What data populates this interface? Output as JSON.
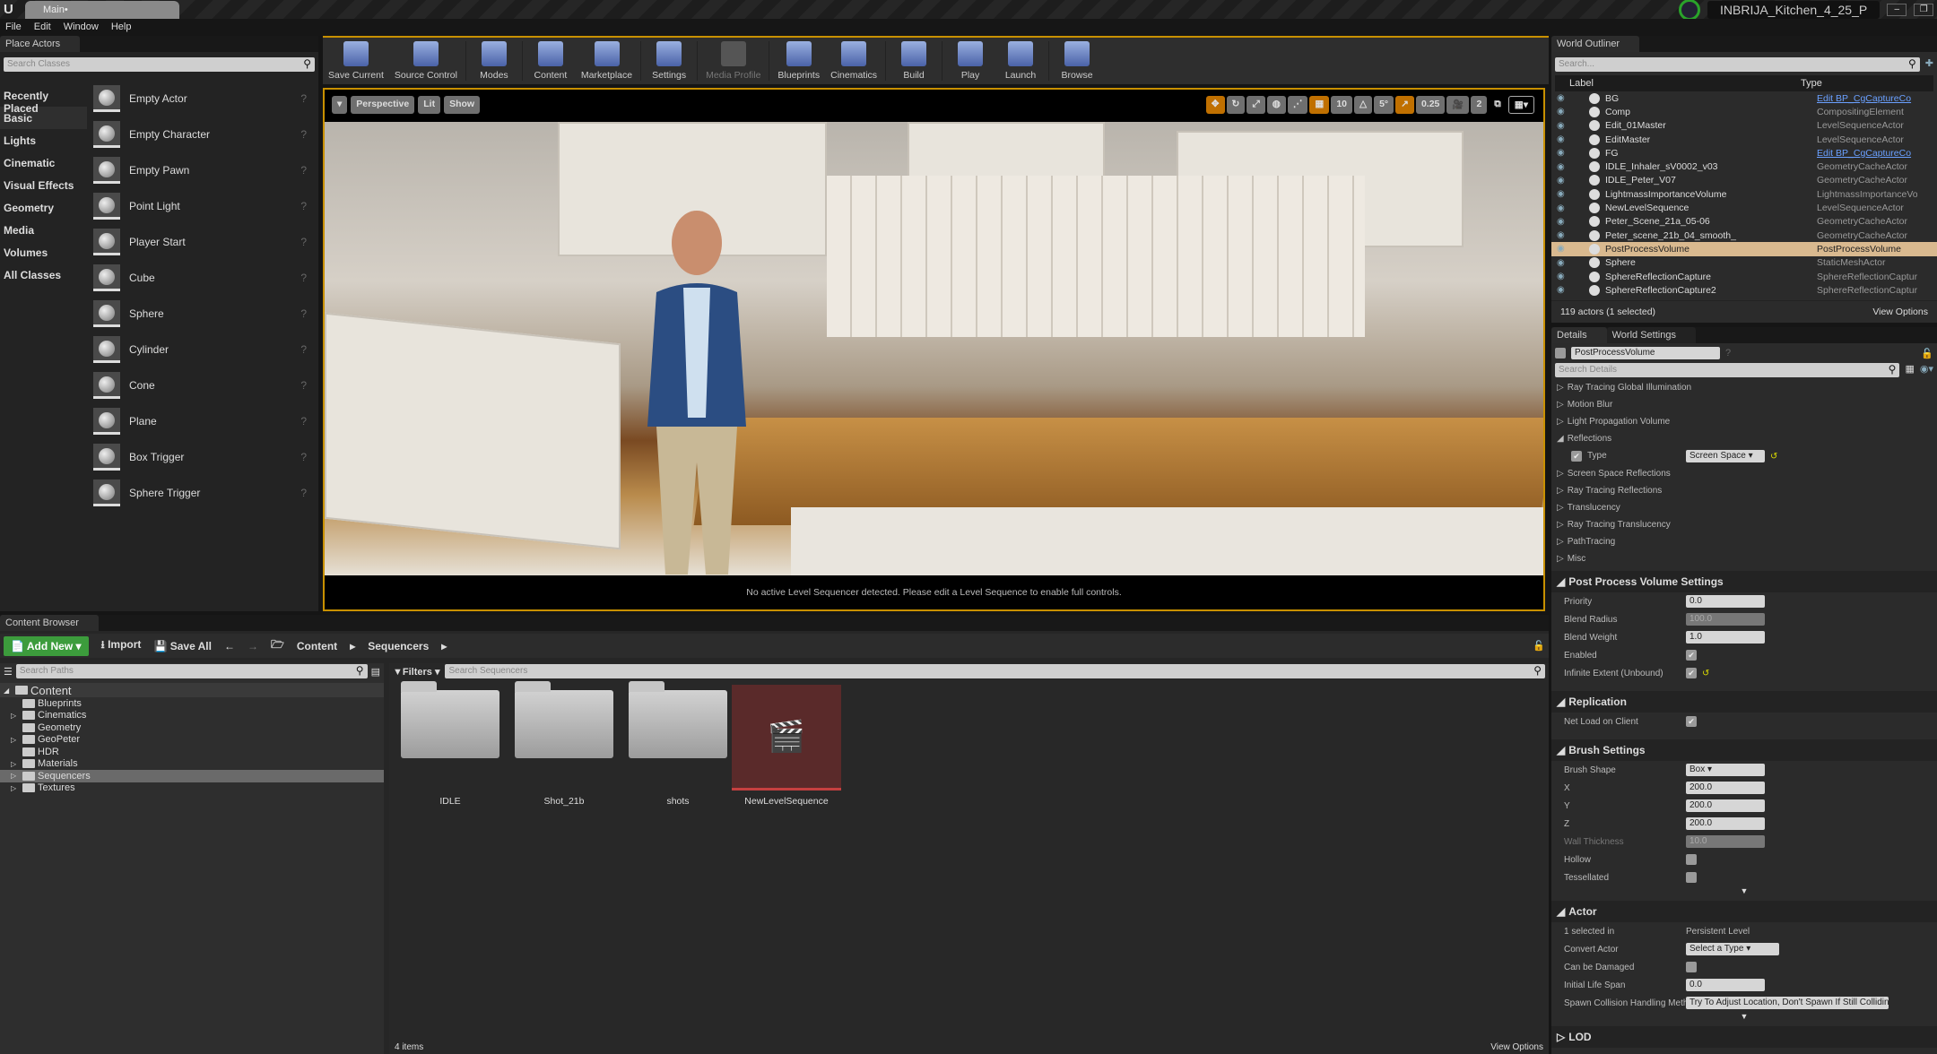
{
  "window": {
    "tab": "Main•",
    "project": "INBRIJA_Kitchen_4_25_P",
    "logo": "U"
  },
  "menu": [
    "File",
    "Edit",
    "Window",
    "Help"
  ],
  "place_actors": {
    "tab": "Place Actors",
    "search_placeholder": "Search Classes",
    "categories": [
      "Recently Placed",
      "Basic",
      "Lights",
      "Cinematic",
      "Visual Effects",
      "Geometry",
      "Media",
      "Volumes",
      "All Classes"
    ],
    "selected_category": "Basic",
    "items": [
      "Empty Actor",
      "Empty Character",
      "Empty Pawn",
      "Point Light",
      "Player Start",
      "Cube",
      "Sphere",
      "Cylinder",
      "Cone",
      "Plane",
      "Box Trigger",
      "Sphere Trigger"
    ]
  },
  "toolbar": [
    {
      "label": "Save Current"
    },
    {
      "label": "Source Control"
    },
    {
      "label": "Modes"
    },
    {
      "label": "Content"
    },
    {
      "label": "Marketplace"
    },
    {
      "label": "Settings"
    },
    {
      "label": "Media Profile",
      "disabled": true
    },
    {
      "label": "Blueprints"
    },
    {
      "label": "Cinematics"
    },
    {
      "label": "Build"
    },
    {
      "label": "Play"
    },
    {
      "label": "Launch"
    },
    {
      "label": "Browse"
    }
  ],
  "viewport": {
    "perspective": "Perspective",
    "lit": "Lit",
    "show": "Show",
    "grid": "10",
    "angle": "5°",
    "scale": "0.25",
    "camera_speed": "2",
    "message": "No active Level Sequencer detected. Please edit a Level Sequence to enable full controls."
  },
  "outliner": {
    "tab": "World Outliner",
    "search_placeholder": "Search...",
    "col_label": "Label",
    "col_type": "Type",
    "rows": [
      {
        "label": "BG",
        "type": "Edit BP_CgCaptureCo",
        "link": true
      },
      {
        "label": "Comp",
        "type": "CompositingElement"
      },
      {
        "label": "Edit_01Master",
        "type": "LevelSequenceActor"
      },
      {
        "label": "EditMaster",
        "type": "LevelSequenceActor"
      },
      {
        "label": "FG",
        "type": "Edit BP_CgCaptureCo",
        "link": true
      },
      {
        "label": "IDLE_Inhaler_sV0002_v03",
        "type": "GeometryCacheActor"
      },
      {
        "label": "IDLE_Peter_V07",
        "type": "GeometryCacheActor"
      },
      {
        "label": "LightmassImportanceVolume",
        "type": "LightmassImportanceVo"
      },
      {
        "label": "NewLevelSequence",
        "type": "LevelSequenceActor"
      },
      {
        "label": "Peter_Scene_21a_05-06",
        "type": "GeometryCacheActor"
      },
      {
        "label": "Peter_scene_21b_04_smooth_",
        "type": "GeometryCacheActor"
      },
      {
        "label": "PostProcessVolume",
        "type": "PostProcessVolume",
        "selected": true
      },
      {
        "label": "Sphere",
        "type": "StaticMeshActor"
      },
      {
        "label": "SphereReflectionCapture",
        "type": "SphereReflectionCapture"
      },
      {
        "label": "SphereReflectionCapture2",
        "type": "SphereReflectionCapture"
      }
    ],
    "status": "119 actors (1 selected)",
    "view_options": "View Options"
  },
  "details": {
    "tab": "Details",
    "tab2": "World Settings",
    "name": "PostProcessVolume",
    "search_placeholder": "Search Details",
    "collapsed_top": [
      "Ray Tracing Global Illumination",
      "Motion Blur",
      "Light Propagation Volume"
    ],
    "reflections": "Reflections",
    "type_label": "Type",
    "type_value": "Screen Space",
    "collapsed_mid": [
      "Screen Space Reflections",
      "Ray Tracing Reflections",
      "Translucency",
      "Ray Tracing Translucency",
      "PathTracing",
      "Misc"
    ],
    "ppv": {
      "title": "Post Process Volume Settings",
      "priority_k": "Priority",
      "priority": "0.0",
      "blend_radius_k": "Blend Radius",
      "blend_radius": "100.0",
      "blend_weight_k": "Blend Weight",
      "blend_weight": "1.0",
      "enabled_k": "Enabled",
      "infinite_k": "Infinite Extent (Unbound)"
    },
    "replication": {
      "title": "Replication",
      "net_load_k": "Net Load on Client"
    },
    "brush": {
      "title": "Brush Settings",
      "shape_k": "Brush Shape",
      "shape": "Box",
      "x_k": "X",
      "x": "200.0",
      "y_k": "Y",
      "y": "200.0",
      "z_k": "Z",
      "z": "200.0",
      "wall_k": "Wall Thickness",
      "wall": "10.0",
      "hollow_k": "Hollow",
      "tess_k": "Tessellated"
    },
    "actor": {
      "title": "Actor",
      "sel_k": "1 selected in",
      "sel": "Persistent Level",
      "convert_k": "Convert Actor",
      "convert": "Select a Type",
      "damaged_k": "Can be Damaged",
      "life_k": "Initial Life Span",
      "life": "0.0",
      "spawn_k": "Spawn Collision Handling Metho",
      "spawn": "Try To Adjust Location, Don't Spawn If Still Colliding"
    },
    "lod": "LOD"
  },
  "content_browser": {
    "tab": "Content Browser",
    "add_new": "Add New",
    "import": "Import",
    "save_all": "Save All",
    "path": [
      "Content",
      "Sequencers"
    ],
    "search_paths": "Search Paths",
    "filters": "Filters",
    "search_assets": "Search Sequencers",
    "tree": [
      {
        "name": "Content",
        "root": true
      },
      {
        "name": "Blueprints"
      },
      {
        "name": "Cinematics",
        "exp": true
      },
      {
        "name": "Geometry"
      },
      {
        "name": "GeoPeter",
        "exp": true
      },
      {
        "name": "HDR"
      },
      {
        "name": "Materials",
        "exp": true
      },
      {
        "name": "Sequencers",
        "exp": true,
        "selected": true
      },
      {
        "name": "Textures",
        "exp": true
      }
    ],
    "assets": [
      {
        "name": "IDLE",
        "kind": "folder"
      },
      {
        "name": "Shot_21b",
        "kind": "folder"
      },
      {
        "name": "shots",
        "kind": "folder"
      },
      {
        "name": "NewLevelSequence",
        "kind": "sequence"
      }
    ],
    "count": "4 items",
    "view_options": "View Options"
  },
  "colors": {
    "accent": "#c89000",
    "add_new": "#3c9c3c",
    "selection": "#d9b98f",
    "link": "#6aa0ff"
  }
}
